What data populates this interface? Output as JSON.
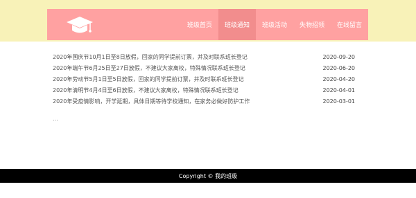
{
  "header": {
    "logo_icon": "graduation-cap-icon",
    "nav": [
      {
        "label": "班级首页",
        "active": false
      },
      {
        "label": "班级通知",
        "active": true
      },
      {
        "label": "班级活动",
        "active": false
      },
      {
        "label": "失物招领",
        "active": false
      },
      {
        "label": "在线留言",
        "active": false
      }
    ]
  },
  "notices": [
    {
      "title": "2020年国庆节10月1日至8日放假，回家的同学提前订票，并及时联系班长登记",
      "date": "2020-09-20"
    },
    {
      "title": "2020年端午节6月25日至27日放假，不建议大家离校，特殊情况联系班长登记",
      "date": "2020-06-20"
    },
    {
      "title": "2020年劳动节5月1日至5日放假，回家的同学提前订票，并及时联系班长登记",
      "date": "2020-04-20"
    },
    {
      "title": "2020年清明节4月4日至6日放假，不建议大家离校，特殊情况联系班长登记",
      "date": "2020-04-01"
    },
    {
      "title": "2020年受疫情影响，开学延期，具体日期等待学校通知，在家务必做好防护工作",
      "date": "2020-03-01"
    }
  ],
  "more_label": "...",
  "footer": {
    "copyright": "Copyright © 我的班级"
  },
  "colors": {
    "top_band": "#f8f2b8",
    "header": "#ffa1a1",
    "nav_active": "#f28d8d",
    "footer": "#000000"
  }
}
